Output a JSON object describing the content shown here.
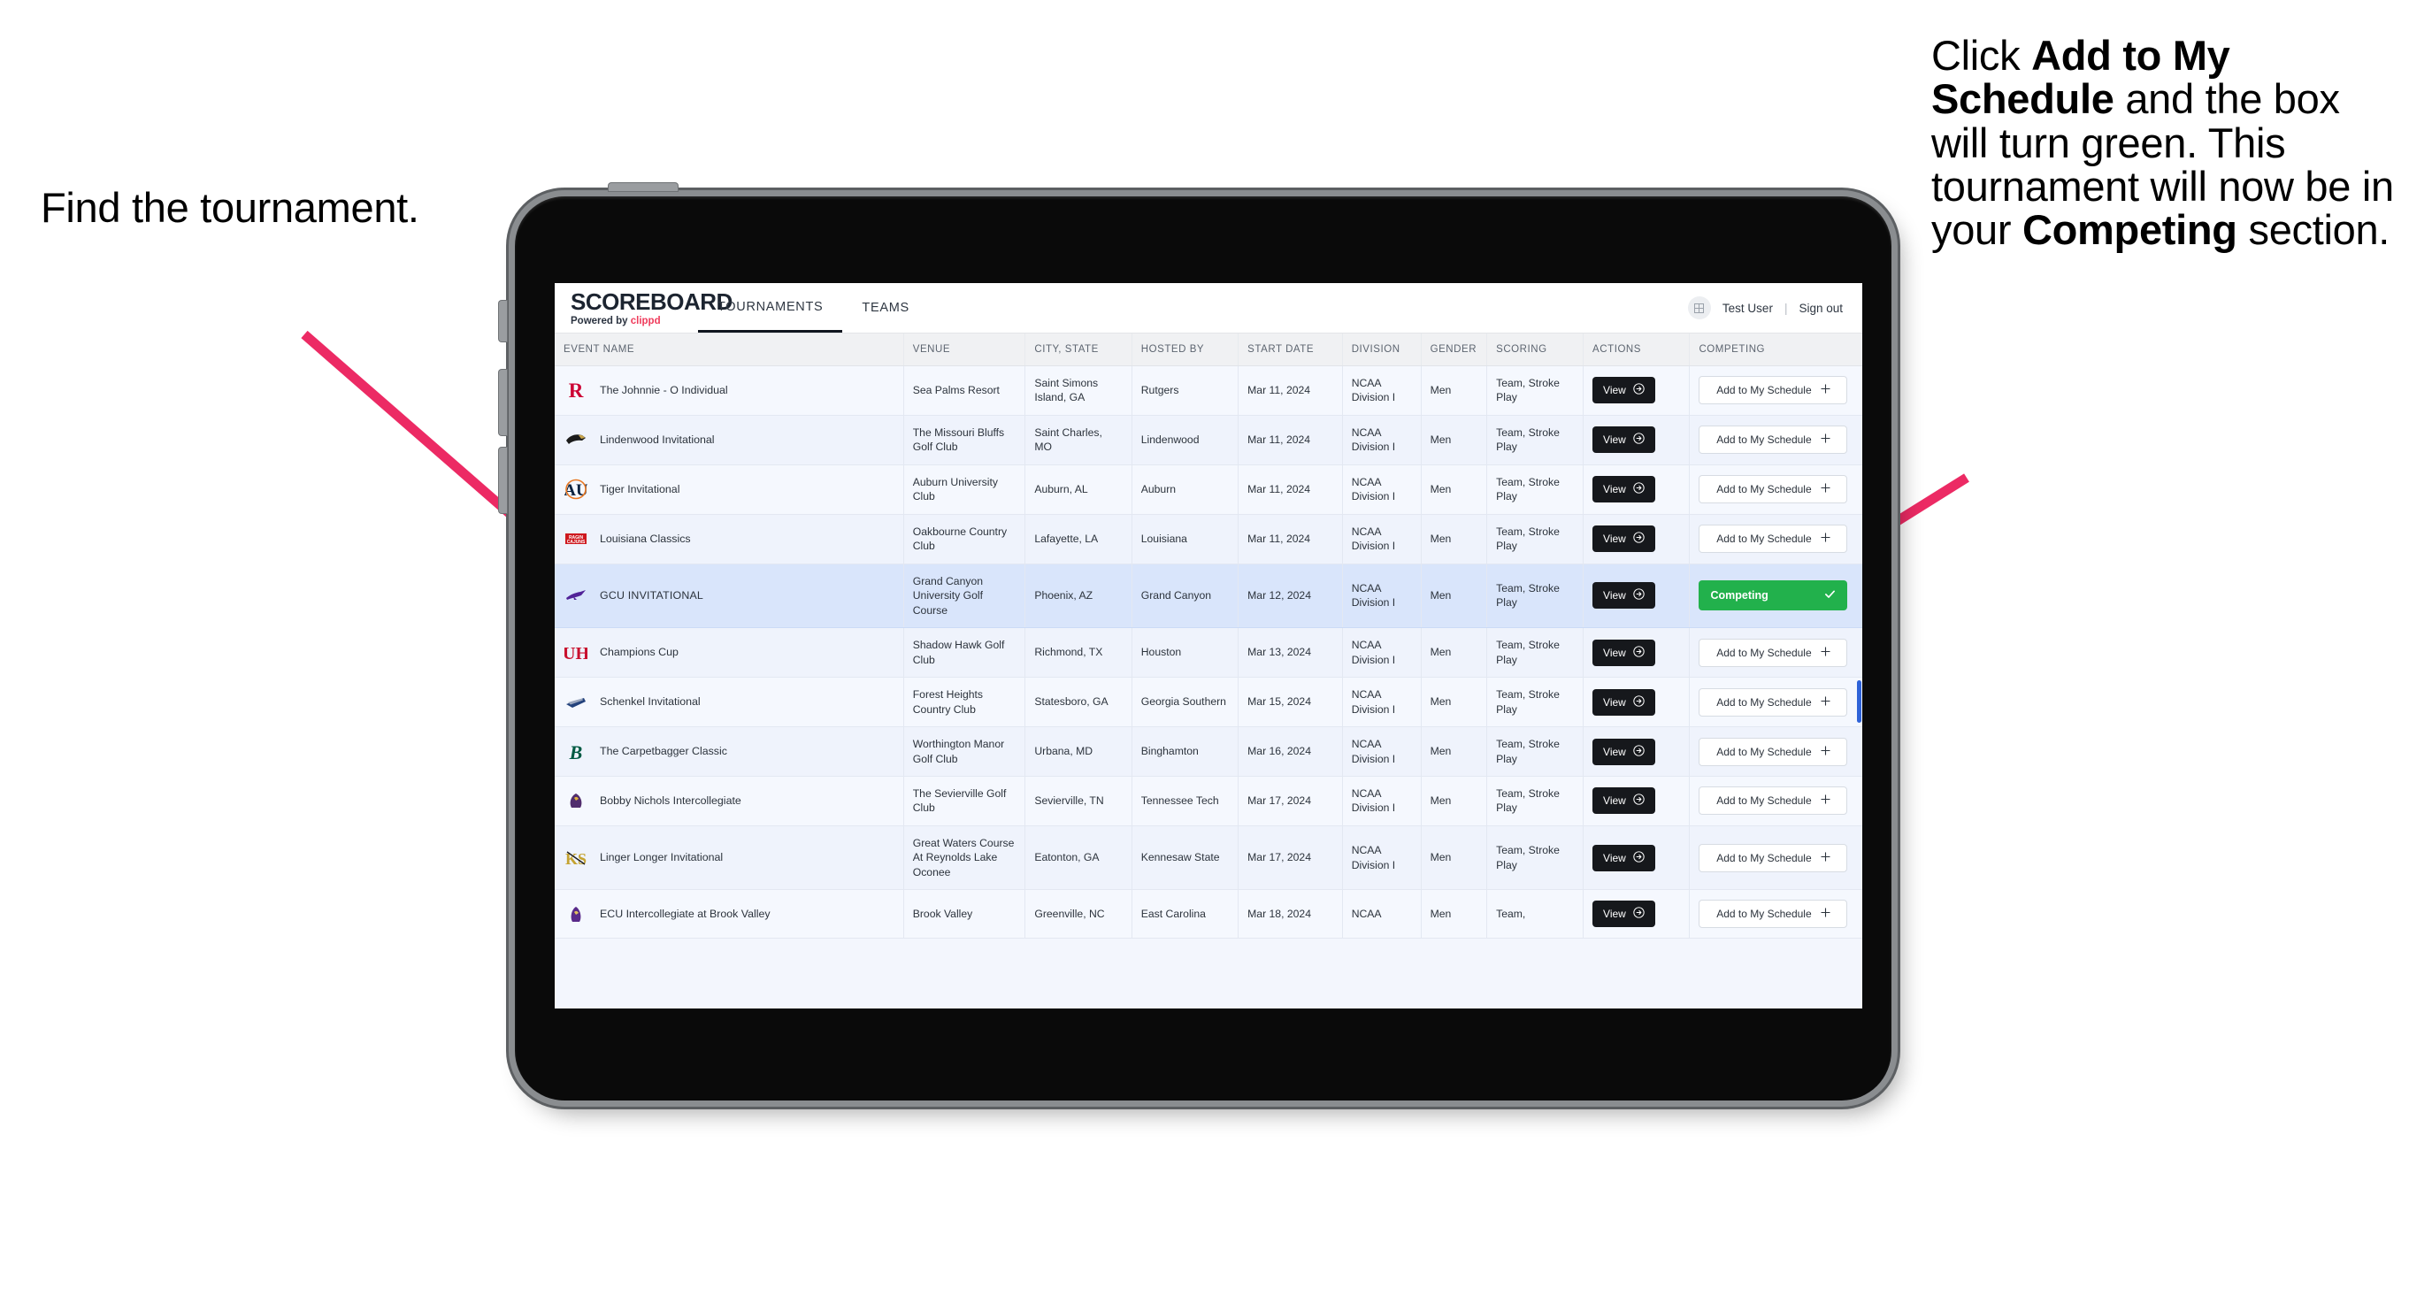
{
  "annotations": {
    "left": "Find the tournament.",
    "right_html": "Click <b>Add to My Schedule</b> and the box will turn green. This tournament will now be in your <b>Competing</b> section."
  },
  "app": {
    "brand_word": "SCOREBOARD",
    "brand_sub_prefix": "Powered by ",
    "brand_sub_name": "clippd",
    "nav": [
      {
        "label": "TOURNAMENTS",
        "active": true
      },
      {
        "label": "TEAMS",
        "active": false
      }
    ],
    "user": {
      "avatar_icon": "grid-icon",
      "name": "Test User",
      "separator": "|",
      "signout": "Sign out"
    }
  },
  "table": {
    "columns": [
      "EVENT NAME",
      "VENUE",
      "CITY, STATE",
      "HOSTED BY",
      "START DATE",
      "DIVISION",
      "GENDER",
      "SCORING",
      "ACTIONS",
      "COMPETING"
    ],
    "action_label": "View",
    "action_icon": "circle-arrow-right-icon",
    "add_label": "Add to My Schedule",
    "add_icon": "plus-icon",
    "competing_label": "Competing",
    "competing_icon": "check-icon",
    "competing_color": "#22b14c",
    "rows": [
      {
        "logo": "rutgers-r-logo",
        "event": "The Johnnie - O Individual",
        "venue": "Sea Palms Resort",
        "city": "Saint Simons Island, GA",
        "host": "Rutgers",
        "date": "Mar 11, 2024",
        "division": "NCAA Division I",
        "gender": "Men",
        "scoring": "Team, Stroke Play",
        "competing": false
      },
      {
        "logo": "lindenwood-lion-logo",
        "event": "Lindenwood Invitational",
        "venue": "The Missouri Bluffs Golf Club",
        "city": "Saint Charles, MO",
        "host": "Lindenwood",
        "date": "Mar 11, 2024",
        "division": "NCAA Division I",
        "gender": "Men",
        "scoring": "Team, Stroke Play",
        "competing": false
      },
      {
        "logo": "auburn-au-logo",
        "event": "Tiger Invitational",
        "venue": "Auburn University Club",
        "city": "Auburn, AL",
        "host": "Auburn",
        "date": "Mar 11, 2024",
        "division": "NCAA Division I",
        "gender": "Men",
        "scoring": "Team, Stroke Play",
        "competing": false
      },
      {
        "logo": "louisiana-ragincajuns-logo",
        "event": "Louisiana Classics",
        "venue": "Oakbourne Country Club",
        "city": "Lafayette, LA",
        "host": "Louisiana",
        "date": "Mar 11, 2024",
        "division": "NCAA Division I",
        "gender": "Men",
        "scoring": "Team, Stroke Play",
        "competing": false
      },
      {
        "logo": "gcu-lopes-logo",
        "event": "GCU INVITATIONAL",
        "venue": "Grand Canyon University Golf Course",
        "city": "Phoenix, AZ",
        "host": "Grand Canyon",
        "date": "Mar 12, 2024",
        "division": "NCAA Division I",
        "gender": "Men",
        "scoring": "Team, Stroke Play",
        "competing": true
      },
      {
        "logo": "houston-uh-logo",
        "event": "Champions Cup",
        "venue": "Shadow Hawk Golf Club",
        "city": "Richmond, TX",
        "host": "Houston",
        "date": "Mar 13, 2024",
        "division": "NCAA Division I",
        "gender": "Men",
        "scoring": "Team, Stroke Play",
        "competing": false
      },
      {
        "logo": "georgia-southern-eagle-logo",
        "event": "Schenkel Invitational",
        "venue": "Forest Heights Country Club",
        "city": "Statesboro, GA",
        "host": "Georgia Southern",
        "date": "Mar 15, 2024",
        "division": "NCAA Division I",
        "gender": "Men",
        "scoring": "Team, Stroke Play",
        "competing": false
      },
      {
        "logo": "binghamton-b-logo",
        "event": "The Carpetbagger Classic",
        "venue": "Worthington Manor Golf Club",
        "city": "Urbana, MD",
        "host": "Binghamton",
        "date": "Mar 16, 2024",
        "division": "NCAA Division I",
        "gender": "Men",
        "scoring": "Team, Stroke Play",
        "competing": false
      },
      {
        "logo": "tennessee-tech-eagle-logo",
        "event": "Bobby Nichols Intercollegiate",
        "venue": "The Sevierville Golf Club",
        "city": "Sevierville, TN",
        "host": "Tennessee Tech",
        "date": "Mar 17, 2024",
        "division": "NCAA Division I",
        "gender": "Men",
        "scoring": "Team, Stroke Play",
        "competing": false
      },
      {
        "logo": "kennesaw-state-ks-logo",
        "event": "Linger Longer Invitational",
        "venue": "Great Waters Course At Reynolds Lake Oconee",
        "city": "Eatonton, GA",
        "host": "Kennesaw State",
        "date": "Mar 17, 2024",
        "division": "NCAA Division I",
        "gender": "Men",
        "scoring": "Team, Stroke Play",
        "competing": false
      },
      {
        "logo": "east-carolina-logo",
        "event": "ECU Intercollegiate at Brook Valley",
        "venue": "Brook Valley",
        "city": "Greenville, NC",
        "host": "East Carolina",
        "date": "Mar 18, 2024",
        "division": "NCAA",
        "gender": "Men",
        "scoring": "Team,",
        "competing": false
      }
    ]
  },
  "colors": {
    "accent_pink": "#ec2a64",
    "green": "#22b14c",
    "dark": "#16181c",
    "row_selected": "#d9e5fb"
  }
}
